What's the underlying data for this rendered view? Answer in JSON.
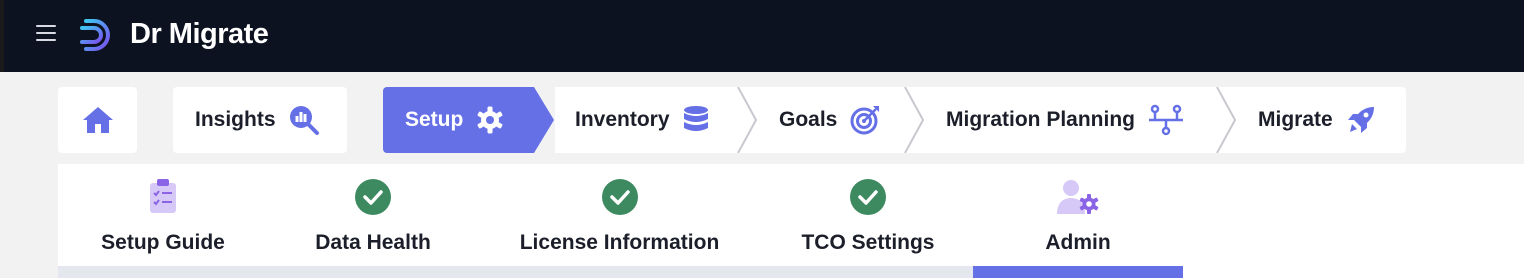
{
  "app": {
    "name": "Dr Migrate"
  },
  "steps": [
    {
      "label": "Insights",
      "icon": "magnifier-chart-icon"
    },
    {
      "label": "Setup",
      "icon": "gear-icon",
      "active": true
    },
    {
      "label": "Inventory",
      "icon": "database-icon"
    },
    {
      "label": "Goals",
      "icon": "target-icon"
    },
    {
      "label": "Migration Planning",
      "icon": "flow-chart-icon"
    },
    {
      "label": "Migrate",
      "icon": "rocket-icon"
    }
  ],
  "tabs": [
    {
      "label": "Setup Guide",
      "icon": "clipboard-checklist-icon"
    },
    {
      "label": "Data Health",
      "icon": "check-circle-icon"
    },
    {
      "label": "License Information",
      "icon": "check-circle-icon"
    },
    {
      "label": "TCO Settings",
      "icon": "check-circle-icon"
    },
    {
      "label": "Admin",
      "icon": "user-gear-icon",
      "active": true
    }
  ],
  "colors": {
    "accent": "#6670e6",
    "success": "#3d8a60",
    "topbar": "#0c1220"
  }
}
